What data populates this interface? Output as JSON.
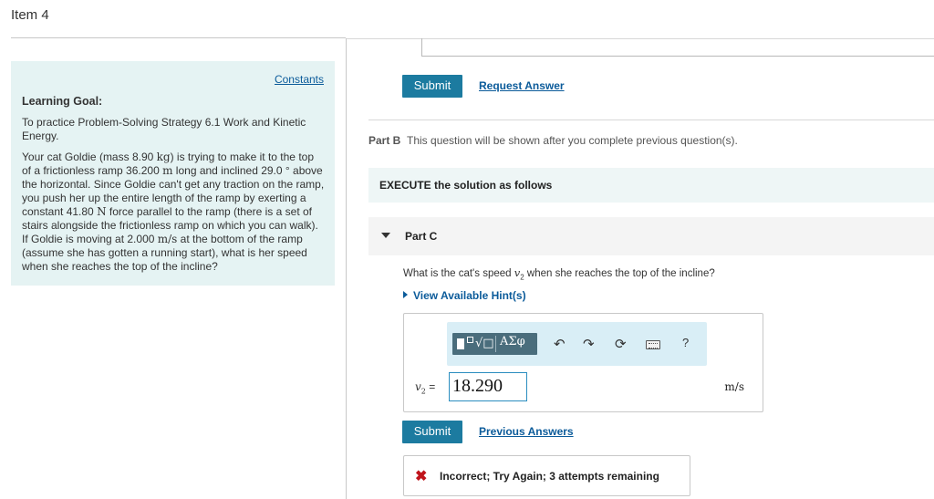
{
  "item_title": "Item 4",
  "goal": {
    "constants_link": "Constants",
    "heading": "Learning Goal:",
    "intro": "To practice Problem-Solving Strategy 6.1 Work and Kinetic Energy.",
    "problem_parts": [
      "Your cat Goldie (mass 8.90 ",
      "kg",
      ") is trying to make it to the top of a frictionless ramp 36.200 ",
      "m",
      " long and inclined 29.0 ° above the horizontal. Since Goldie can't get any traction on the ramp, you push her up the entire length of the ramp by exerting a constant 41.80 ",
      "N",
      " force parallel to the ramp (there is a set of stairs alongside the frictionless ramp on which you can walk). If Goldie is moving at 2.000 ",
      "m/s",
      " at the bottom of the ramp (assume she has gotten a running start), what is her speed when she reaches the top of the incline?"
    ]
  },
  "part_a": {
    "submit_label": "Submit",
    "request_answer_label": "Request Answer"
  },
  "part_b": {
    "label": "Part B",
    "text": "This question will be shown after you complete previous question(s)."
  },
  "execute": {
    "text": "EXECUTE the solution as follows"
  },
  "part_c": {
    "label": "Part C",
    "question_pre": "What is the cat's speed ",
    "question_var": "v",
    "question_sub": "2",
    "question_post": " when she reaches the top of the incline?",
    "hint_label": "View Available Hint(s)",
    "toolbar": {
      "templates_icon": "templates-icon",
      "greek_label": "ΑΣφ",
      "undo_icon": "undo-icon",
      "redo_icon": "redo-icon",
      "reset_icon": "reset-icon",
      "keyboard_icon": "keyboard-icon",
      "help_label": "?"
    },
    "answer_var": "v",
    "answer_sub": "2",
    "answer_eq": " =",
    "answer_value": "18.290",
    "unit": "m/s",
    "submit_label": "Submit",
    "previous_answers_label": "Previous Answers",
    "feedback_icon": "✖",
    "feedback_text": "Incorrect; Try Again; 3 attempts remaining"
  },
  "colors": {
    "accent": "#1c7ba0",
    "link": "#0b5b9a",
    "goal_bg": "#e5f3f3",
    "error": "#c0141b"
  }
}
